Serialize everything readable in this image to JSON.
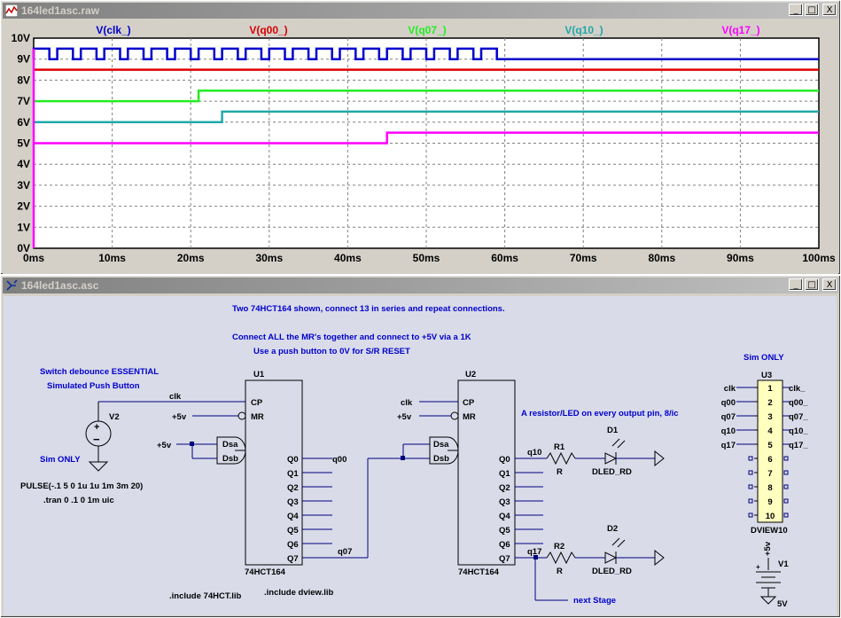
{
  "waveform_window": {
    "title": "164led1asc.raw",
    "buttons": {
      "minimize": "_",
      "maximize": "□",
      "close": "X"
    }
  },
  "schematic_window": {
    "title": "164led1asc.asc",
    "buttons": {
      "minimize": "_",
      "maximize": "□",
      "close": "X"
    }
  },
  "colors": {
    "clk": "#0000cc",
    "q00": "#dd0000",
    "q07": "#22ee22",
    "q10": "#20a8a8",
    "q17": "#ff00ff",
    "wire": "#000080",
    "component": "#000000",
    "comment": "#0000cc"
  },
  "chart_data": {
    "type": "line",
    "title": "",
    "xlabel": "",
    "ylabel": "",
    "xlim": [
      0,
      100
    ],
    "ylim": [
      0,
      10
    ],
    "x_unit": "ms",
    "y_unit": "V",
    "grid": true,
    "x_ticks": [
      "0ms",
      "10ms",
      "20ms",
      "30ms",
      "40ms",
      "50ms",
      "60ms",
      "70ms",
      "80ms",
      "90ms",
      "100ms"
    ],
    "y_ticks": [
      "0V",
      "1V",
      "2V",
      "3V",
      "4V",
      "5V",
      "6V",
      "7V",
      "8V",
      "9V",
      "10V"
    ],
    "series": [
      {
        "name": "V(clk_)",
        "color_key": "clk",
        "kind": "clock",
        "low": 9.0,
        "high": 9.5,
        "period": 3,
        "high_time": 2,
        "start": 0,
        "stop": 58
      },
      {
        "name": "V(q00_)",
        "color_key": "q00",
        "kind": "step",
        "points": [
          [
            0,
            8.5
          ],
          [
            100,
            8.5
          ]
        ]
      },
      {
        "name": "V(q07_)",
        "color_key": "q07",
        "kind": "step",
        "points": [
          [
            0,
            7.0
          ],
          [
            21,
            7.0
          ],
          [
            21,
            7.5
          ],
          [
            100,
            7.5
          ]
        ]
      },
      {
        "name": "V(q10_)",
        "color_key": "q10",
        "kind": "step",
        "points": [
          [
            0,
            6.0
          ],
          [
            24,
            6.0
          ],
          [
            24,
            6.5
          ],
          [
            100,
            6.5
          ]
        ]
      },
      {
        "name": "V(q17_)",
        "color_key": "q17",
        "kind": "step",
        "points": [
          [
            0,
            5.0
          ],
          [
            45,
            5.0
          ],
          [
            45,
            5.5
          ],
          [
            100,
            5.5
          ]
        ]
      }
    ]
  },
  "schematic": {
    "notes": {
      "n1": "Two 74HCT164 shown, connect 13 in series and repeat connections.",
      "n2": "Connect ALL the MR's together and connect to +5V via a 1K",
      "n3": "Use a push button to 0V for S/R RESET",
      "n4": "Switch debounce ESSENTIAL",
      "n5": "Simulated Push Button",
      "n6": "Sim ONLY",
      "n7": "PULSE(-.1 5 0 1u 1u 1m 3m 20)",
      "n8": ".tran 0 .1 0 1m uic",
      "n9": "A resistor/LED on every output pin, 8/ic",
      "n10": "Sim ONLY",
      "n11": ".include 74HCT.lib",
      "n12": ".include dview.lib",
      "n13": "next Stage"
    },
    "u1": {
      "ref": "U1",
      "part": "74HCT164",
      "cp": "CP",
      "mr": "MR",
      "dsa": "Dsa",
      "dsb": "Dsb",
      "outputs": [
        "Q0",
        "Q1",
        "Q2",
        "Q3",
        "Q4",
        "Q5",
        "Q6",
        "Q7"
      ]
    },
    "u2": {
      "ref": "U2",
      "part": "74HCT164",
      "cp": "CP",
      "mr": "MR",
      "dsa": "Dsa",
      "dsb": "Dsb",
      "outputs": [
        "Q0",
        "Q1",
        "Q2",
        "Q3",
        "Q4",
        "Q5",
        "Q6",
        "Q7"
      ]
    },
    "u3": {
      "ref": "U3",
      "part": "DVIEW10",
      "pins": [
        "1",
        "2",
        "3",
        "4",
        "5",
        "6",
        "7",
        "8",
        "9",
        "10"
      ],
      "left_labels": [
        "clk",
        "q00",
        "q07",
        "q10",
        "q17"
      ],
      "right_labels": [
        "clk_",
        "q00_",
        "q07_",
        "q10_",
        "q17_"
      ]
    },
    "v2": {
      "ref": "V2"
    },
    "v1": {
      "ref": "V1",
      "value": "5V",
      "net": "+5v"
    },
    "r1": {
      "ref": "R1",
      "value": "R"
    },
    "r2": {
      "ref": "R2",
      "value": "R"
    },
    "d1": {
      "ref": "D1",
      "value": "DLED_RD"
    },
    "d2": {
      "ref": "D2",
      "value": "DLED_RD"
    },
    "nets": {
      "clk1": "clk",
      "vcc1": "+5v",
      "vcc2": "+5v",
      "clk2": "clk",
      "vcc3": "+5v",
      "q00": "q00",
      "q07": "q07",
      "q10": "q10",
      "q17": "q17"
    }
  }
}
